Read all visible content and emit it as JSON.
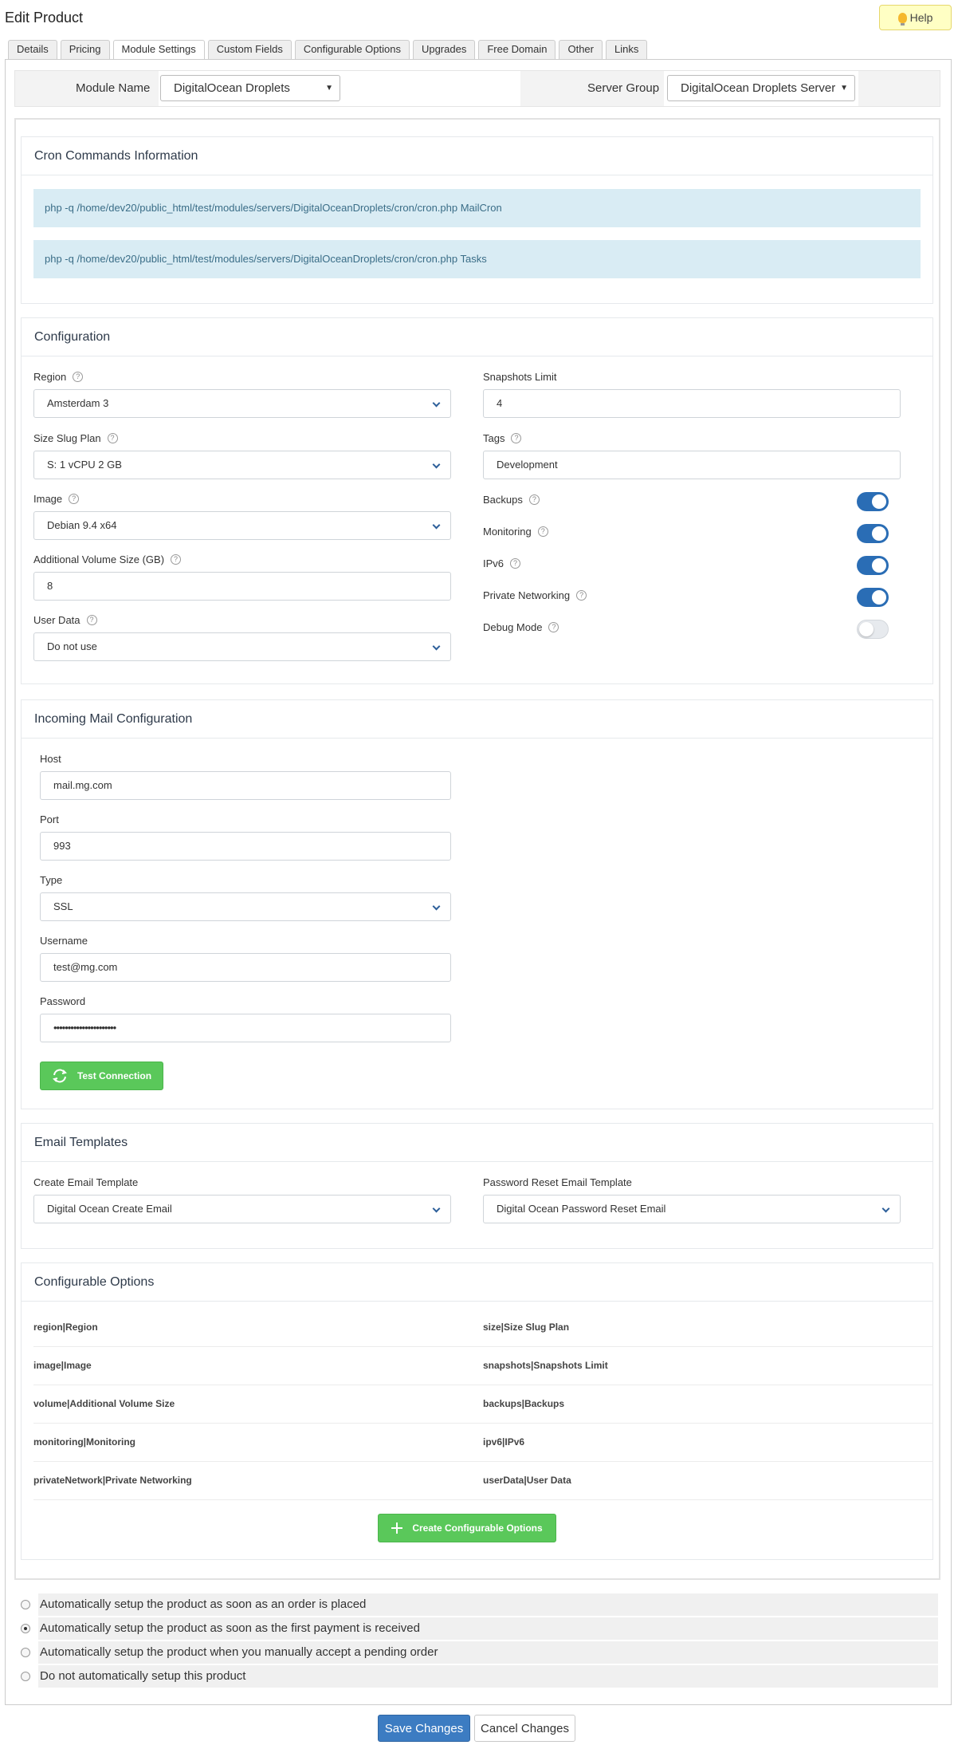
{
  "page": {
    "title": "Edit Product",
    "help_label": "Help"
  },
  "tabs": [
    "Details",
    "Pricing",
    "Module Settings",
    "Custom Fields",
    "Configurable Options",
    "Upgrades",
    "Free Domain",
    "Other",
    "Links"
  ],
  "module": {
    "name_label": "Module Name",
    "name_value": "DigitalOcean Droplets",
    "group_label": "Server Group",
    "group_value": "DigitalOcean Droplets Server"
  },
  "cron": {
    "title": "Cron Commands Information",
    "lines": [
      "php -q /home/dev20/public_html/test/modules/servers/DigitalOceanDroplets/cron/cron.php MailCron",
      "php -q /home/dev20/public_html/test/modules/servers/DigitalOceanDroplets/cron/cron.php Tasks"
    ]
  },
  "config": {
    "title": "Configuration",
    "region_label": "Region",
    "region_value": "Amsterdam 3",
    "size_label": "Size Slug Plan",
    "size_value": "S: 1 vCPU 2 GB",
    "image_label": "Image",
    "image_value": "Debian 9.4 x64",
    "volume_label": "Additional Volume Size (GB)",
    "volume_value": "8",
    "userdata_label": "User Data",
    "userdata_value": "Do not use",
    "snapshots_label": "Snapshots Limit",
    "snapshots_value": "4",
    "tags_label": "Tags",
    "tags_value": "Development",
    "toggles": [
      {
        "label": "Backups",
        "on": true
      },
      {
        "label": "Monitoring",
        "on": true
      },
      {
        "label": "IPv6",
        "on": true
      },
      {
        "label": "Private Networking",
        "on": true
      },
      {
        "label": "Debug Mode",
        "on": false
      }
    ]
  },
  "mail": {
    "title": "Incoming Mail Configuration",
    "host_label": "Host",
    "host_value": "mail.mg.com",
    "port_label": "Port",
    "port_value": "993",
    "type_label": "Type",
    "type_value": "SSL",
    "username_label": "Username",
    "username_value": "test@mg.com",
    "password_label": "Password",
    "password_value": "••••••••••••••••••••••",
    "test_button": "Test Connection"
  },
  "email_templates": {
    "title": "Email Templates",
    "create_label": "Create Email Template",
    "create_value": "Digital Ocean Create Email",
    "reset_label": "Password Reset Email Template",
    "reset_value": "Digital Ocean Password Reset Email"
  },
  "conf_options": {
    "title": "Configurable Options",
    "rows": [
      [
        "region|Region",
        "size|Size Slug Plan"
      ],
      [
        "image|Image",
        "snapshots|Snapshots Limit"
      ],
      [
        "volume|Additional Volume Size",
        "backups|Backups"
      ],
      [
        "monitoring|Monitoring",
        "ipv6|IPv6"
      ],
      [
        "privateNetwork|Private Networking",
        "userData|User Data"
      ]
    ],
    "create_button": "Create Configurable Options"
  },
  "setup_options": [
    {
      "label": "Automatically setup the product as soon as an order is placed",
      "selected": false
    },
    {
      "label": "Automatically setup the product as soon as the first payment is received",
      "selected": true
    },
    {
      "label": "Automatically setup the product when you manually accept a pending order",
      "selected": false
    },
    {
      "label": "Do not automatically setup this product",
      "selected": false
    }
  ],
  "footer": {
    "save": "Save Changes",
    "cancel": "Cancel Changes"
  }
}
